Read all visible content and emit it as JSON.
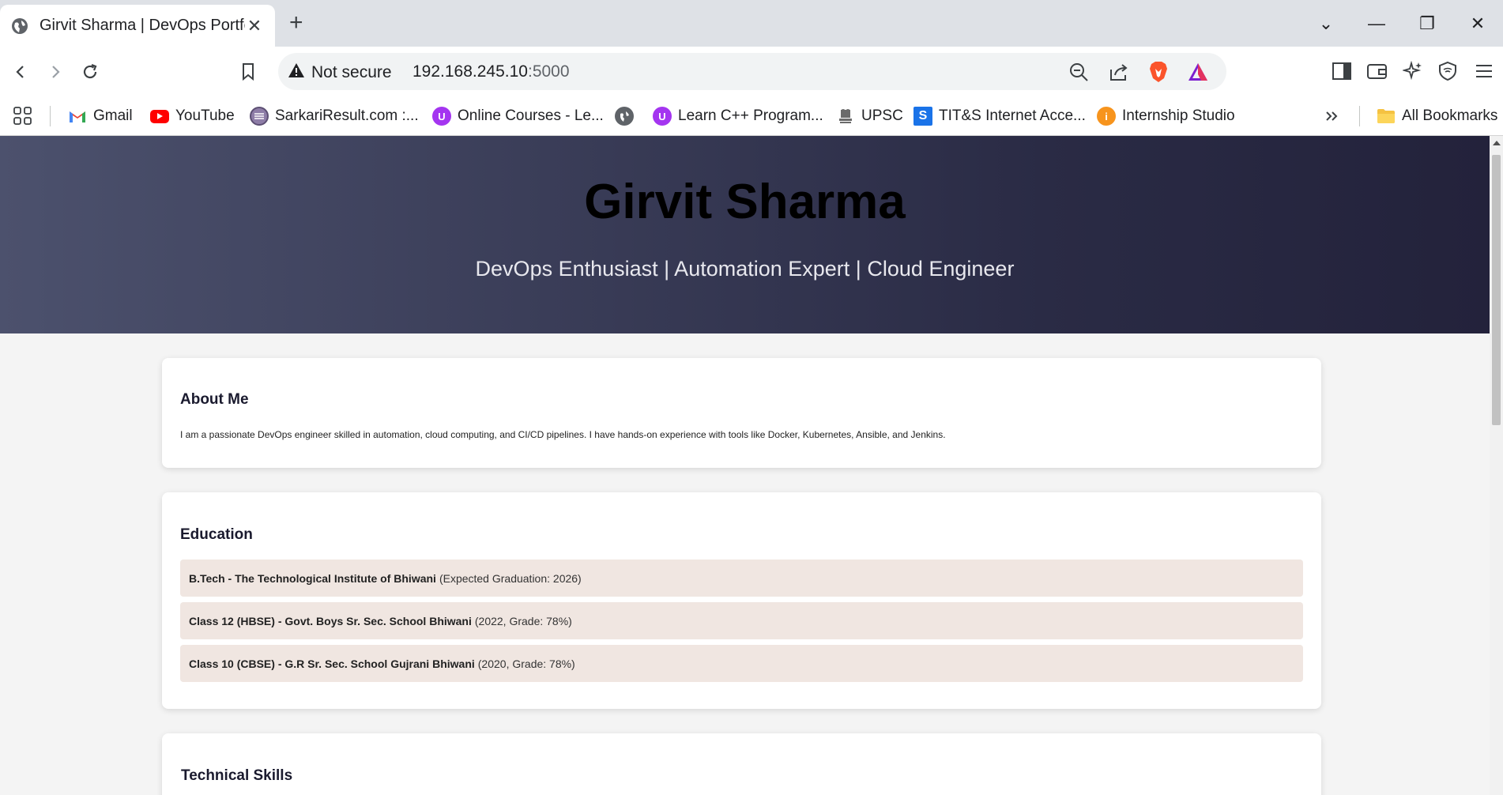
{
  "browser": {
    "tab_title": "Girvit Sharma | DevOps Portfolio",
    "security_label": "Not secure",
    "url_host": "192.168.245.10",
    "url_port": ":5000",
    "bookmarks": [
      {
        "label": "Gmail",
        "icon": "gmail-icon"
      },
      {
        "label": "YouTube",
        "icon": "youtube-icon"
      },
      {
        "label": "SarkariResult.com :...",
        "icon": "sarkari-icon"
      },
      {
        "label": "Online Courses - Le...",
        "icon": "udemy-icon"
      },
      {
        "label": "",
        "icon": "globe-icon"
      },
      {
        "label": "Learn C++ Program...",
        "icon": "udemy-icon"
      },
      {
        "label": "UPSC",
        "icon": "emblem-icon"
      },
      {
        "label": "TIT&S Internet Acce...",
        "icon": "s-logo-icon"
      },
      {
        "label": "Internship Studio",
        "icon": "internship-icon"
      }
    ],
    "all_bookmarks_label": "All Bookmarks"
  },
  "hero": {
    "name": "Girvit Sharma",
    "tagline": "DevOps Enthusiast | Automation Expert | Cloud Engineer"
  },
  "about": {
    "heading": "About Me",
    "text": "I am a passionate DevOps engineer skilled in automation, cloud computing, and CI/CD pipelines. I have hands-on experience with tools like Docker, Kubernetes, Ansible, and Jenkins."
  },
  "education": {
    "heading": "Education",
    "items": [
      {
        "title": "B.Tech - The Technological Institute of Bhiwani",
        "detail": "(Expected Graduation: 2026)"
      },
      {
        "title": "Class 12 (HBSE) - Govt. Boys Sr. Sec. School Bhiwani",
        "detail": "(2022, Grade: 78%)"
      },
      {
        "title": "Class 10 (CBSE) - G.R Sr. Sec. School Gujrani Bhiwani",
        "detail": "(2020, Grade: 78%)"
      }
    ]
  },
  "skills": {
    "heading": "Technical Skills"
  }
}
